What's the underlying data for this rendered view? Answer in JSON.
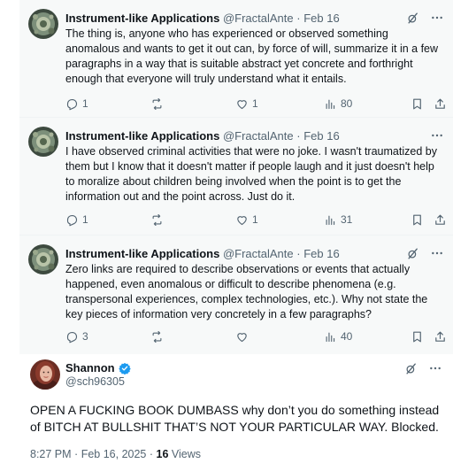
{
  "replies": [
    {
      "display_name": "Instrument-like Applications",
      "handle": "@FractalAnte",
      "separator": "·",
      "date": "Feb 16",
      "text": "The thing is, anyone who has experienced or observed something anomalous and wants to get it out can, by force of will, summarize it in a few paragraphs in a way that is suitable abstract yet concrete and forthright enough that everyone will truly understand what it entails.",
      "reply_count": "1",
      "retweet_count": "",
      "like_count": "1",
      "view_count": "80"
    },
    {
      "display_name": "Instrument-like Applications",
      "handle": "@FractalAnte",
      "separator": "·",
      "date": "Feb 16",
      "text": "I have observed criminal activities that were no joke. I wasn't traumatized by them but I know that it doesn't matter if people laugh and it just doesn't help to moralize about children being involved when the point is to get the information out and the point across. Just do it.",
      "reply_count": "1",
      "retweet_count": "",
      "like_count": "1",
      "view_count": "31"
    },
    {
      "display_name": "Instrument-like Applications",
      "handle": "@FractalAnte",
      "separator": "·",
      "date": "Feb 16",
      "text": "Zero links are required to describe observations or events that actually happened, even anomalous or difficult to describe phenomena (e.g. transpersonal experiences, complex technologies, etc.). Why not state the key pieces of information very concretely in a few paragraphs?",
      "reply_count": "3",
      "retweet_count": "",
      "like_count": "",
      "view_count": "40"
    }
  ],
  "main_tweet": {
    "display_name": "Shannon",
    "handle": "@sch96305",
    "text": "OPEN A FUCKING BOOK DUMBASS why don’t you do something instead of BITCH AT BULLSHIT THAT’S NOT YOUR PARTICULAR WAY. Blocked.",
    "time": "8:27 PM",
    "separator": "·",
    "date": "Feb 16, 2025",
    "separator2": "·",
    "views_count": "16",
    "views_label": "Views"
  },
  "icons": {
    "more": "more-dots-icon",
    "grok": "grok-slash-icon",
    "reply": "reply-bubble-icon",
    "retweet": "retweet-icon",
    "like": "heart-icon",
    "views": "analytics-bars-icon",
    "bookmark": "bookmark-icon",
    "share": "share-icon",
    "verified": "verified-badge-icon"
  },
  "colors": {
    "reply_bg": "#f7f9f9",
    "text": "#0f1419",
    "muted": "#536471",
    "verified": "#1d9bf0"
  }
}
